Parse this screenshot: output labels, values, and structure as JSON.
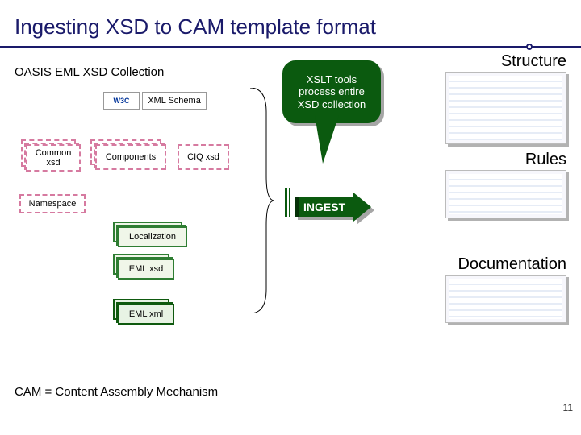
{
  "title": "Ingesting XSD to CAM template format",
  "subtitle": "OASIS EML XSD Collection",
  "w3c": "W3C",
  "xml_schema": "XML Schema",
  "boxes": {
    "common_xsd": "Common\nxsd",
    "components": "Components",
    "ciq_xsd": "CIQ xsd",
    "namespace": "Namespace",
    "localization": "Localization",
    "eml_xsd": "EML xsd",
    "eml_xml": "EML xml"
  },
  "callout": "XSLT tools process entire XSD collection",
  "ingest": "INGEST",
  "out": {
    "structure": "Structure",
    "rules": "Rules",
    "documentation": "Documentation"
  },
  "footer": "CAM = Content Assembly Mechanism",
  "page": "11"
}
